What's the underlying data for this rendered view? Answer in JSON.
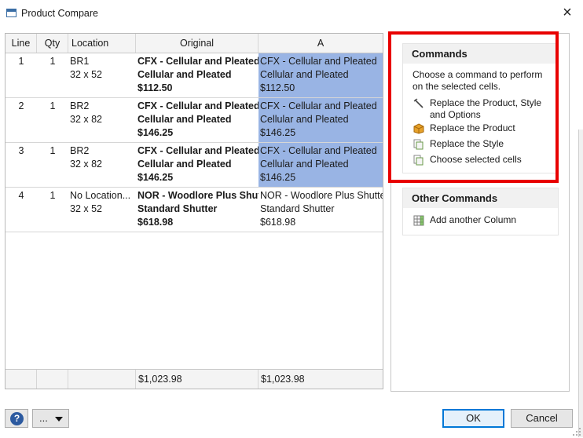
{
  "window": {
    "title": "Product Compare",
    "close_glyph": "×"
  },
  "grid": {
    "columns": [
      "Line",
      "Qty",
      "Location",
      "Original",
      "A"
    ],
    "rows": [
      {
        "line": "1",
        "qty": "1",
        "location": [
          "BR1",
          "32 x 52"
        ],
        "original": [
          "CFX - Cellular and Pleated",
          "Cellular and Pleated",
          "$112.50"
        ],
        "a": [
          "CFX - Cellular and Pleated",
          "Cellular and Pleated",
          "$112.50"
        ],
        "a_selected": true
      },
      {
        "line": "2",
        "qty": "1",
        "location": [
          "BR2",
          "32 x 82"
        ],
        "original": [
          "CFX - Cellular and Pleated",
          "Cellular and Pleated",
          "$146.25"
        ],
        "a": [
          "CFX - Cellular and Pleated",
          "Cellular and Pleated",
          "$146.25"
        ],
        "a_selected": true
      },
      {
        "line": "3",
        "qty": "1",
        "location": [
          "BR2",
          "32 x 82"
        ],
        "original": [
          "CFX - Cellular and Pleated",
          "Cellular and Pleated",
          "$146.25"
        ],
        "a": [
          "CFX - Cellular and Pleated",
          "Cellular and Pleated",
          "$146.25"
        ],
        "a_selected": true
      },
      {
        "line": "4",
        "qty": "1",
        "location": [
          "No Location...",
          "32 x 52"
        ],
        "original": [
          "NOR - Woodlore Plus Shutter",
          "Standard Shutter",
          "$618.98"
        ],
        "a": [
          "NOR - Woodlore Plus Shutter",
          "Standard Shutter",
          "$618.98"
        ],
        "a_selected": false
      }
    ],
    "totals": {
      "original": "$1,023.98",
      "a": "$1,023.98"
    }
  },
  "commands": {
    "title": "Commands",
    "description": "Choose a command to perform on the selected cells.",
    "items": [
      {
        "label": "Replace the Product, Style and Options",
        "icon": "wand-icon"
      },
      {
        "label": "Replace the Product",
        "icon": "box-icon"
      },
      {
        "label": "Replace the Style",
        "icon": "documents-icon"
      },
      {
        "label": "Choose selected cells",
        "icon": "documents-icon"
      }
    ]
  },
  "other_commands": {
    "title": "Other Commands",
    "items": [
      {
        "label": "Add another Column",
        "icon": "grid-add-icon"
      }
    ]
  },
  "footer": {
    "help_label": "?",
    "more_label": "...",
    "ok_label": "OK",
    "cancel_label": "Cancel"
  },
  "colors": {
    "selection": "#99b4e4",
    "highlight_border": "#e80000",
    "ok_border": "#0078d7"
  }
}
